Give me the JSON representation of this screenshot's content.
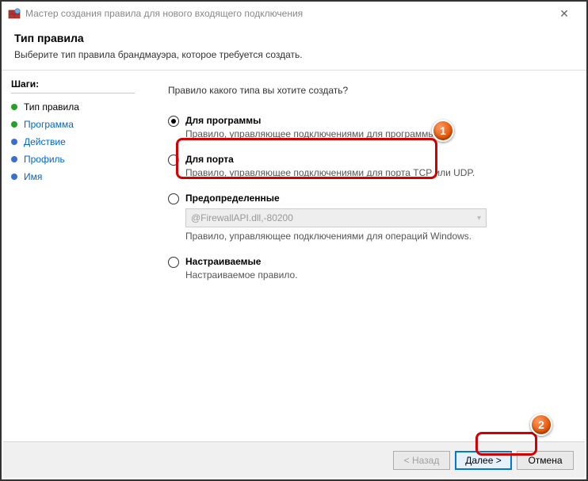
{
  "window": {
    "title": "Мастер создания правила для нового входящего подключения"
  },
  "header": {
    "title": "Тип правила",
    "subtitle": "Выберите тип правила брандмауэра, которое требуется создать."
  },
  "sidebar": {
    "title": "Шаги:",
    "steps": [
      {
        "label": "Тип правила"
      },
      {
        "label": "Программа"
      },
      {
        "label": "Действие"
      },
      {
        "label": "Профиль"
      },
      {
        "label": "Имя"
      }
    ]
  },
  "main": {
    "question": "Правило какого типа вы хотите создать?",
    "options": {
      "program": {
        "title": "Для программы",
        "desc": "Правило, управляющее подключениями для программы."
      },
      "port": {
        "title": "Для порта",
        "desc": "Правило, управляющее подключениями для порта TCP или UDP."
      },
      "predefined": {
        "title": "Предопределенные",
        "dropdown": "@FirewallAPI.dll,-80200",
        "desc": "Правило, управляющее подключениями для операций Windows."
      },
      "custom": {
        "title": "Настраиваемые",
        "desc": "Настраиваемое правило."
      }
    }
  },
  "footer": {
    "back": "< Назад",
    "next": "Далее >",
    "cancel": "Отмена"
  },
  "markers": {
    "one": "1",
    "two": "2"
  }
}
